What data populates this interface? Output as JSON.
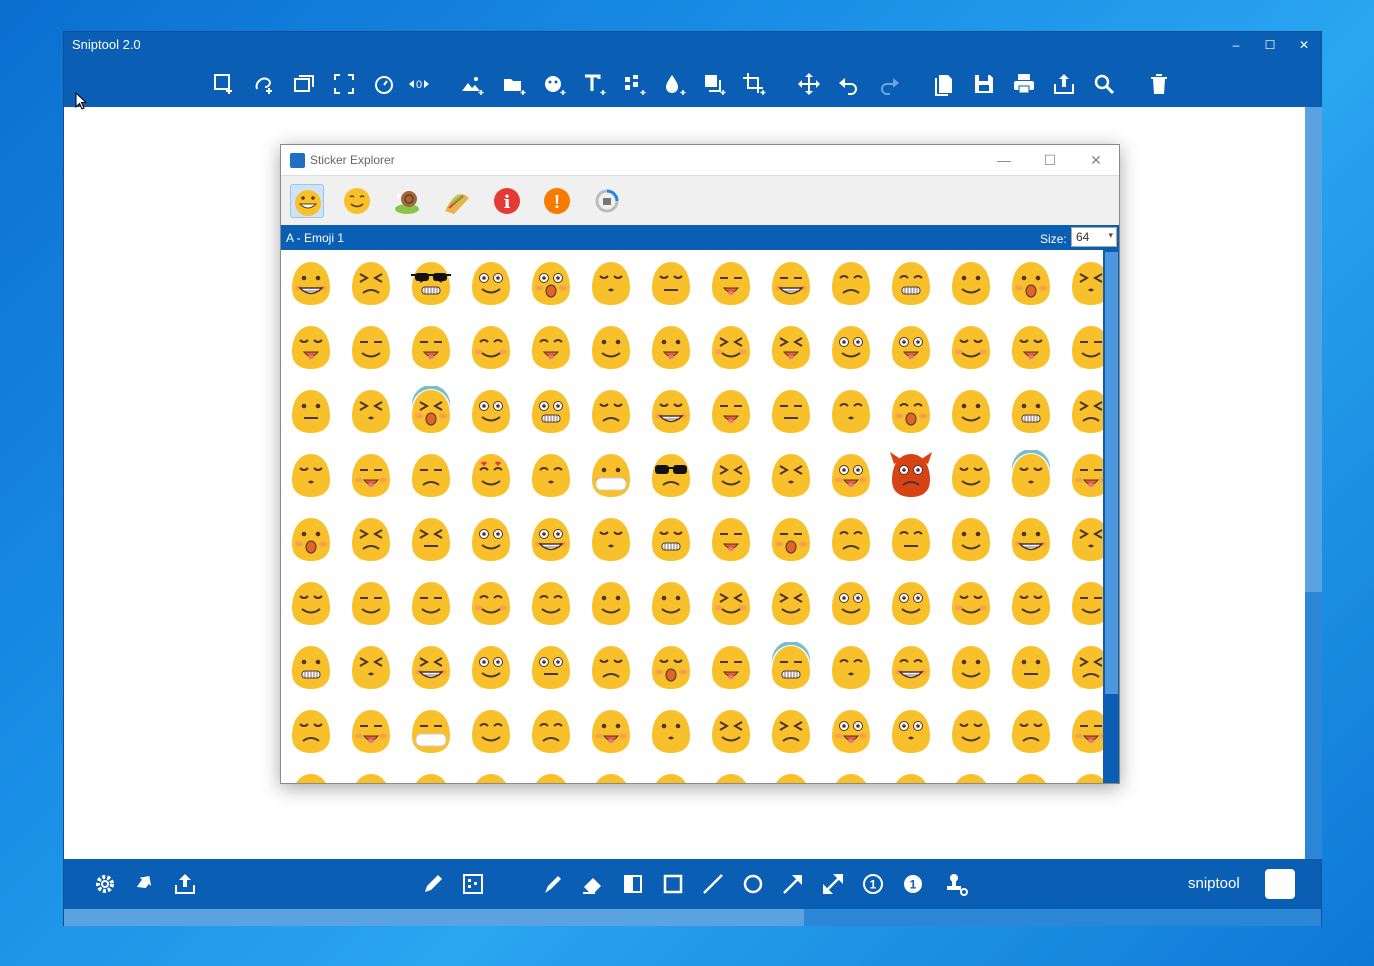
{
  "main_window": {
    "title": "Sniptool 2.0",
    "controls": {
      "minimize": "–",
      "maximize": "☐",
      "close": "✕"
    },
    "toolbar_icons": [
      "rect-select-icon",
      "freeform-select-icon",
      "window-select-icon",
      "fullscreen-select-icon",
      "timer-icon",
      "delay-value-icon",
      "image-add-icon",
      "folder-add-icon",
      "sticker-add-icon",
      "text-add-icon",
      "pattern-add-icon",
      "fill-add-icon",
      "resize-add-icon",
      "crop-add-icon",
      "move-icon",
      "undo-icon",
      "redo-icon",
      "copy-icon",
      "save-icon",
      "print-icon",
      "share-icon",
      "search-icon",
      "delete-icon"
    ],
    "delay_value": "0",
    "bottom_icons": [
      "settings-icon",
      "export-arrow-icon",
      "upload-icon",
      "pencil-icon",
      "blur-icon",
      "pen-icon",
      "eraser-icon",
      "highlight-icon",
      "rectangle-icon",
      "line-icon",
      "circle-icon",
      "arrow-icon",
      "double-arrow-icon",
      "counter-outline-icon",
      "counter-filled-icon",
      "stamp-icon"
    ],
    "brand": "sniptool"
  },
  "sticker_explorer": {
    "title": "Sticker Explorer",
    "controls": {
      "minimize": "—",
      "maximize": "☐",
      "close": "✕"
    },
    "tabs": [
      {
        "name": "tab-emoji-1",
        "active": true
      },
      {
        "name": "tab-emoji-2",
        "active": false
      },
      {
        "name": "tab-animals",
        "active": false
      },
      {
        "name": "tab-food",
        "active": false
      },
      {
        "name": "tab-info",
        "active": false
      },
      {
        "name": "tab-warning",
        "active": false
      },
      {
        "name": "tab-loading",
        "active": false
      }
    ],
    "category": "A - Emoji 1",
    "size_label": "Size:",
    "size_value": "64",
    "grid_rows": 9,
    "grid_cols": 14
  },
  "colors": {
    "accent": "#0a5fb4",
    "emoji_yellow": "#f8c12b"
  }
}
